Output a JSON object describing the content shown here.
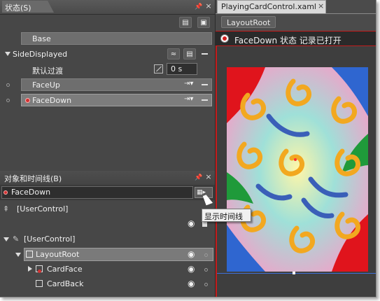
{
  "states_panel": {
    "title": "状态(S)",
    "base_label": "Base",
    "group": {
      "name": "SideDisplayed",
      "default_transition_label": "默认过渡",
      "default_transition_value": "0 s"
    },
    "states": [
      {
        "name": "FaceUp",
        "selected": false,
        "recording": false
      },
      {
        "name": "FaceDown",
        "selected": true,
        "recording": true
      }
    ]
  },
  "objects_panel": {
    "title": "对象和时间线(B)",
    "timeline_name": "FaceDown",
    "root_scope": "[UserControl]",
    "tree": [
      {
        "label": "[UserControl]",
        "indent": 0
      },
      {
        "label": "LayoutRoot",
        "indent": 1
      },
      {
        "label": "CardFace",
        "indent": 2
      },
      {
        "label": "CardBack",
        "indent": 2
      }
    ]
  },
  "tooltip": {
    "text": "显示时间线"
  },
  "document": {
    "tab_title": "PlayingCardControl.xaml",
    "breadcrumb": "LayoutRoot",
    "recording_text": "FaceDown 状态 记录已打开"
  },
  "colors": {
    "recording_red": "#c41c1c",
    "panel_bg": "#474747",
    "selected_row": "#7d7d7d"
  },
  "icons": [
    "pin-icon",
    "close-icon",
    "add-state-group-icon",
    "add-state-icon",
    "transition-icon",
    "minus-icon",
    "eye-icon",
    "lock-icon",
    "record-dot-icon",
    "show-timeline-icon",
    "expand-arrow-icon"
  ]
}
